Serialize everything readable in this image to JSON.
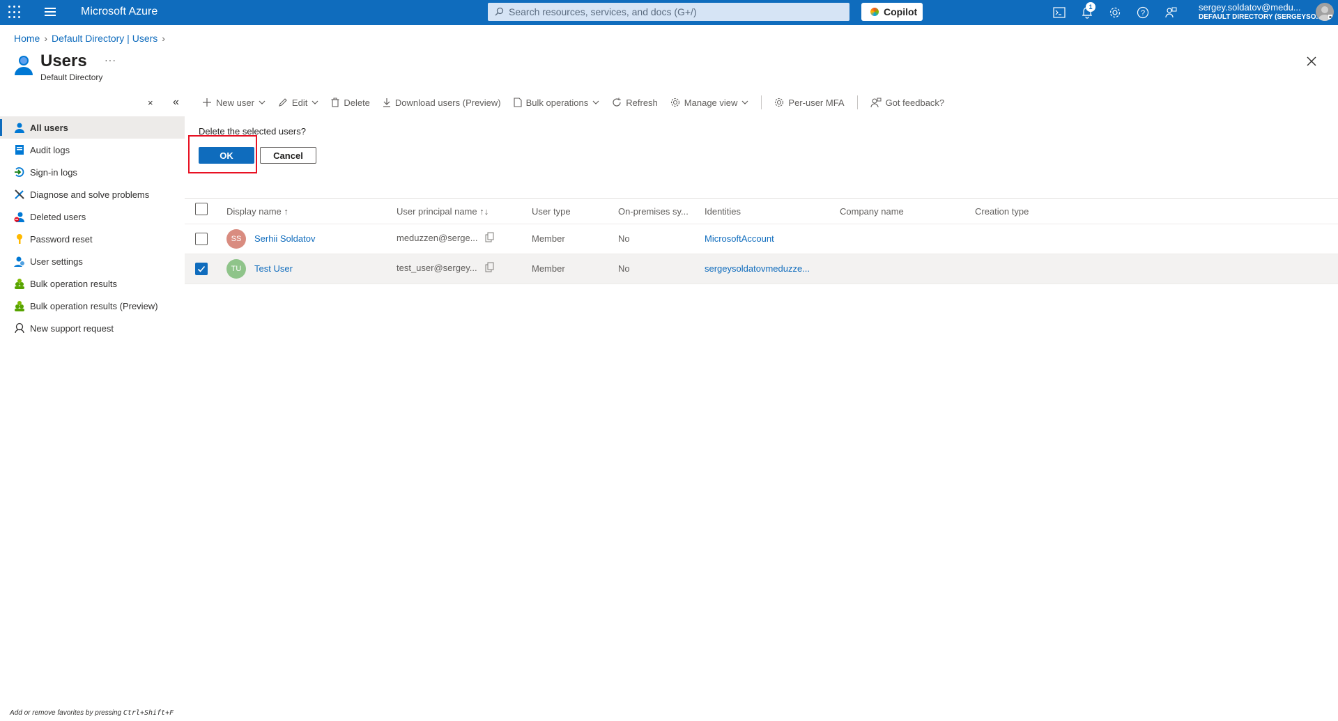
{
  "topbar": {
    "brand": "Microsoft Azure",
    "search_placeholder": "Search resources, services, and docs (G+/)",
    "copilot_label": "Copilot",
    "notifications_count": "1",
    "account_name": "sergey.soldatov@medu...",
    "account_directory": "DEFAULT DIRECTORY (SERGEYSO..."
  },
  "breadcrumb": {
    "home": "Home",
    "directory": "Default Directory | Users"
  },
  "page": {
    "title": "Users",
    "more": "···",
    "subtitle": "Default Directory"
  },
  "sidebar": {
    "items": [
      {
        "label": "All users",
        "icon": "user-icon",
        "active": true
      },
      {
        "label": "Audit logs",
        "icon": "audit-log-icon"
      },
      {
        "label": "Sign-in logs",
        "icon": "sign-in-icon"
      },
      {
        "label": "Diagnose and solve problems",
        "icon": "wrench-icon"
      },
      {
        "label": "Deleted users",
        "icon": "deleted-user-icon"
      },
      {
        "label": "Password reset",
        "icon": "key-icon"
      },
      {
        "label": "User settings",
        "icon": "user-settings-icon"
      },
      {
        "label": "Bulk operation results",
        "icon": "users-group-icon"
      },
      {
        "label": "Bulk operation results (Preview)",
        "icon": "users-group-icon"
      },
      {
        "label": "New support request",
        "icon": "support-icon"
      }
    ]
  },
  "toolbar": {
    "new_user": "New user",
    "edit": "Edit",
    "delete": "Delete",
    "download": "Download users (Preview)",
    "bulk": "Bulk operations",
    "refresh": "Refresh",
    "manage_view": "Manage view",
    "mfa": "Per-user MFA",
    "feedback": "Got feedback?"
  },
  "dialog": {
    "question": "Delete the selected users?",
    "ok": "OK",
    "cancel": "Cancel"
  },
  "grid": {
    "columns": {
      "display_name": "Display name ↑",
      "upn": "User principal name ↑↓",
      "user_type": "User type",
      "on_prem": "On-premises sy...",
      "identities": "Identities",
      "company": "Company name",
      "creation": "Creation type"
    },
    "rows": [
      {
        "initials": "SS",
        "avatar_color": "#d98c80",
        "name": "Serhii Soldatov",
        "upn": "meduzzen@serge...",
        "user_type": "Member",
        "on_prem": "No",
        "identities": "MicrosoftAccount",
        "selected": false
      },
      {
        "initials": "TU",
        "avatar_color": "#8fc48a",
        "name": "Test User",
        "upn": "test_user@sergey...",
        "user_type": "Member",
        "on_prem": "No",
        "identities": "sergeysoldatovmeduzze...",
        "selected": true
      }
    ]
  },
  "footer": {
    "hint_prefix": "Add or remove favorites by pressing ",
    "hint_keys": "Ctrl+Shift+F"
  }
}
